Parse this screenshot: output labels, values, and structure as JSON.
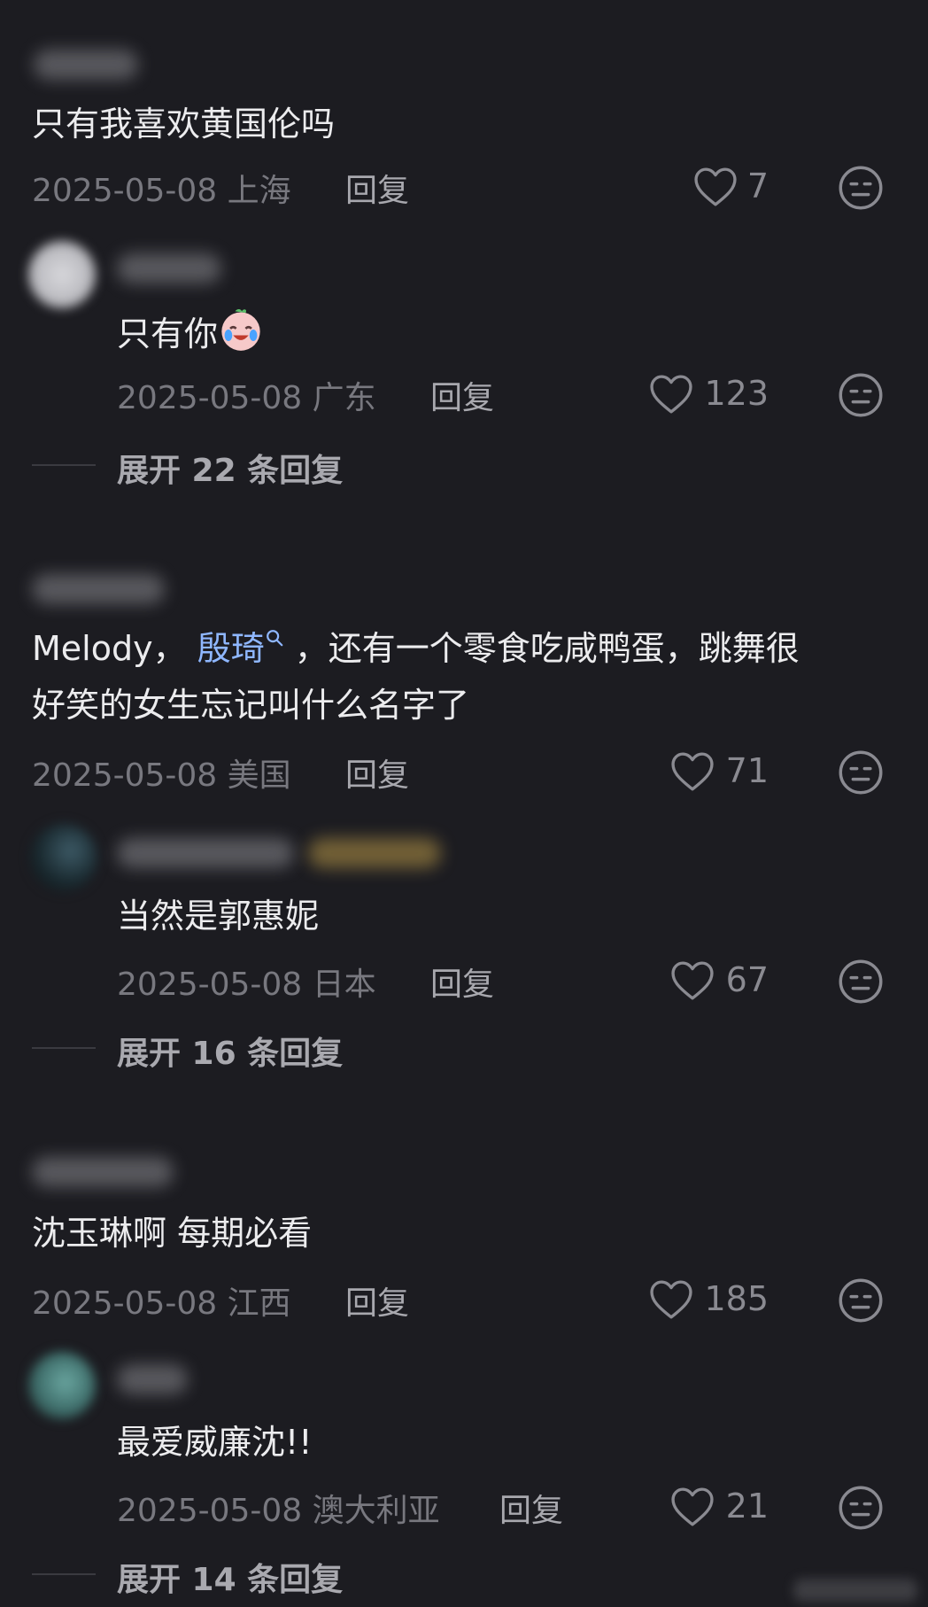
{
  "comments": [
    {
      "text": "只有我喜欢黄国伦吗",
      "date": "2025-05-08",
      "location": "上海",
      "reply_label": "回复",
      "likes": "7"
    },
    {
      "text": "只有你",
      "date": "2025-05-08",
      "location": "广东",
      "reply_label": "回复",
      "likes": "123",
      "expand_label": "展开 22 条回复"
    },
    {
      "text_line1_before": "Melody，",
      "mention": "殷琦",
      "text_line1_after": "，还有一个零食吃咸鸭蛋，跳舞很",
      "text_line2": "好笑的女生忘记叫什么名字了",
      "date": "2025-05-08",
      "location": "美国",
      "reply_label": "回复",
      "likes": "71"
    },
    {
      "text": "当然是郭惠妮",
      "date": "2025-05-08",
      "location": "日本",
      "reply_label": "回复",
      "likes": "67",
      "expand_label": "展开 16 条回复"
    },
    {
      "text": "沈玉琳啊 每期必看",
      "date": "2025-05-08",
      "location": "江西",
      "reply_label": "回复",
      "likes": "185"
    },
    {
      "text": "最爱威廉沈!!",
      "date": "2025-05-08",
      "location": "澳大利亚",
      "reply_label": "回复",
      "likes": "21",
      "expand_label": "展开 14 条回复"
    }
  ],
  "icons": {
    "like": "heart-outline-icon",
    "dislike": "neutral-face-icon",
    "mention": "search-icon",
    "emoji": "crying-laughing-face-emoji"
  },
  "colors": {
    "background": "#1c1c21",
    "text": "#ececee",
    "meta": "#78787f",
    "mention": "#8fb7ff"
  }
}
